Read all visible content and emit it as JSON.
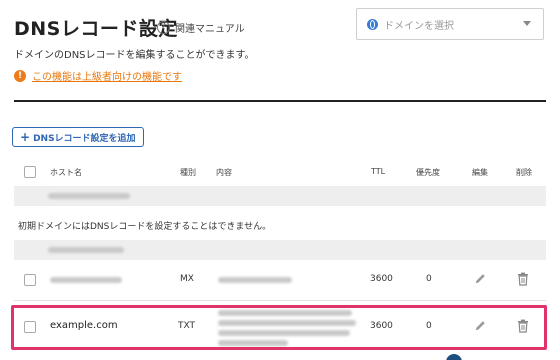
{
  "header": {
    "title": "DNSレコード設定",
    "help_label": "関連マニュアル",
    "domain_select_placeholder": "ドメインを選択"
  },
  "description": "ドメインのDNSレコードを編集することができます。",
  "warning": {
    "link_text": "この機能は上級者向けの機能です"
  },
  "add_button_label": "DNSレコード設定を追加",
  "table": {
    "headers": {
      "host": "ホスト名",
      "type": "種別",
      "content": "内容",
      "ttl": "TTL",
      "priority": "優先度",
      "edit": "編集",
      "delete": "削除"
    },
    "initial_domain_notice": "初期ドメインにはDNSレコードを設定することはできません。",
    "rows": [
      {
        "host": "",
        "type": "MX",
        "ttl": "3600",
        "priority": "0"
      },
      {
        "host": "example.com",
        "type": "TXT",
        "ttl": "3600",
        "priority": "0"
      }
    ]
  },
  "colors": {
    "accent": "#2f66b5",
    "warning": "#ef7c1a",
    "highlight": "#e0336a"
  },
  "icons": [
    "help-icon",
    "globe-icon",
    "chevron-down-icon",
    "warning-icon",
    "plus-icon",
    "pencil-icon",
    "trash-icon"
  ]
}
